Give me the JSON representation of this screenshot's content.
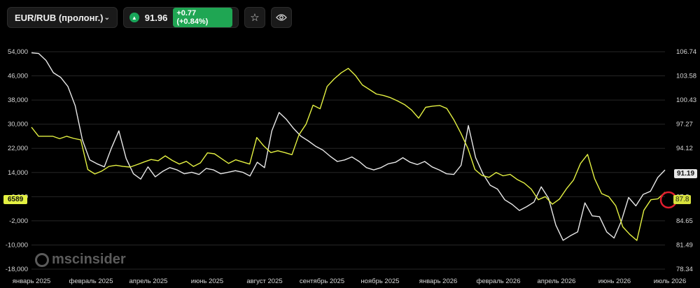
{
  "toolbar": {
    "symbol": "EUR/RUB (пролонг.)",
    "price": "91.96",
    "change": "+0.77 (+0.84%)"
  },
  "tags": {
    "left_value": "6589",
    "right_value": "91.19",
    "right_value2": "87.8"
  },
  "brand": {
    "text": "mscinsider"
  },
  "chart_data": {
    "type": "line",
    "left_axis": {
      "ticks": [
        "54,000",
        "46,000",
        "38,000",
        "30,000",
        "22,000",
        "14,000",
        "6,000",
        "-2,000",
        "-10,000",
        "-18,000"
      ],
      "ylim": [
        -18000,
        54000
      ]
    },
    "right_axis": {
      "ticks": [
        "106.74",
        "103.58",
        "100.43",
        "97.27",
        "94.12",
        "90.96",
        "87.8",
        "84.65",
        "81.49",
        "78.34"
      ],
      "ylim": [
        78.34,
        106.74
      ]
    },
    "x_ticks": [
      "январь 2025",
      "февраль 2025",
      "апрель 2025",
      "июнь 2025",
      "август 2025",
      "сентябрь 2025",
      "ноябрь 2025",
      "январь 2026",
      "февраль 2026",
      "апрель 2026",
      "июнь 2026",
      "июль 2026"
    ],
    "colors": {
      "white_series": "#e8e8e8",
      "yellow_series": "#e4f142",
      "marker": "#e11d2e"
    },
    "series": [
      {
        "axis": "right",
        "values": [
          106.6,
          106.5,
          105.6,
          104.0,
          103.4,
          102.2,
          99.7,
          95.2,
          92.6,
          92.1,
          91.7,
          94.2,
          96.4,
          92.8,
          90.8,
          90.1,
          91.7,
          90.4,
          91.1,
          91.6,
          91.3,
          90.8,
          91.0,
          90.7,
          91.5,
          91.3,
          90.8,
          91.0,
          91.2,
          91.0,
          90.5,
          92.3,
          91.6,
          96.4,
          98.8,
          97.9,
          96.7,
          95.7,
          95.1,
          94.4,
          93.9,
          93.1,
          92.4,
          92.6,
          93.0,
          92.4,
          91.6,
          91.3,
          91.6,
          92.1,
          92.3,
          92.9,
          92.3,
          92.0,
          92.4,
          91.7,
          91.3,
          90.8,
          90.7,
          91.9,
          97.1,
          92.9,
          90.8,
          89.3,
          88.8,
          87.4,
          86.8,
          86.0,
          86.5,
          87.1,
          89.1,
          87.6,
          84.1,
          82.1,
          82.7,
          83.2,
          87.0,
          85.3,
          85.2,
          83.2,
          82.4,
          84.6,
          87.7,
          86.6,
          88.1,
          88.5,
          90.3,
          91.3
        ]
      },
      {
        "axis": "left",
        "values": [
          29000,
          26000,
          26000,
          26000,
          25200,
          26000,
          25300,
          24800,
          15000,
          13500,
          14500,
          16000,
          16400,
          16000,
          15800,
          16600,
          17500,
          18300,
          17900,
          19500,
          18000,
          16800,
          17700,
          16000,
          17200,
          20500,
          20200,
          18600,
          17000,
          18200,
          17500,
          16800,
          25600,
          22800,
          20600,
          21200,
          20600,
          19900,
          26500,
          30000,
          36300,
          35100,
          42500,
          45000,
          47000,
          48500,
          46200,
          43000,
          41500,
          40000,
          39500,
          38800,
          37700,
          36500,
          34700,
          32000,
          35600,
          36000,
          36200,
          35200,
          31500,
          27000,
          22000,
          15000,
          13000,
          12400,
          14000,
          12900,
          13400,
          11700,
          10500,
          8500,
          5000,
          6000,
          3500,
          5200,
          8600,
          11500,
          17000,
          20000,
          12000,
          7000,
          6000,
          3000,
          -4000,
          -6500,
          -8500,
          1500,
          5000,
          5300,
          7500
        ]
      }
    ]
  }
}
